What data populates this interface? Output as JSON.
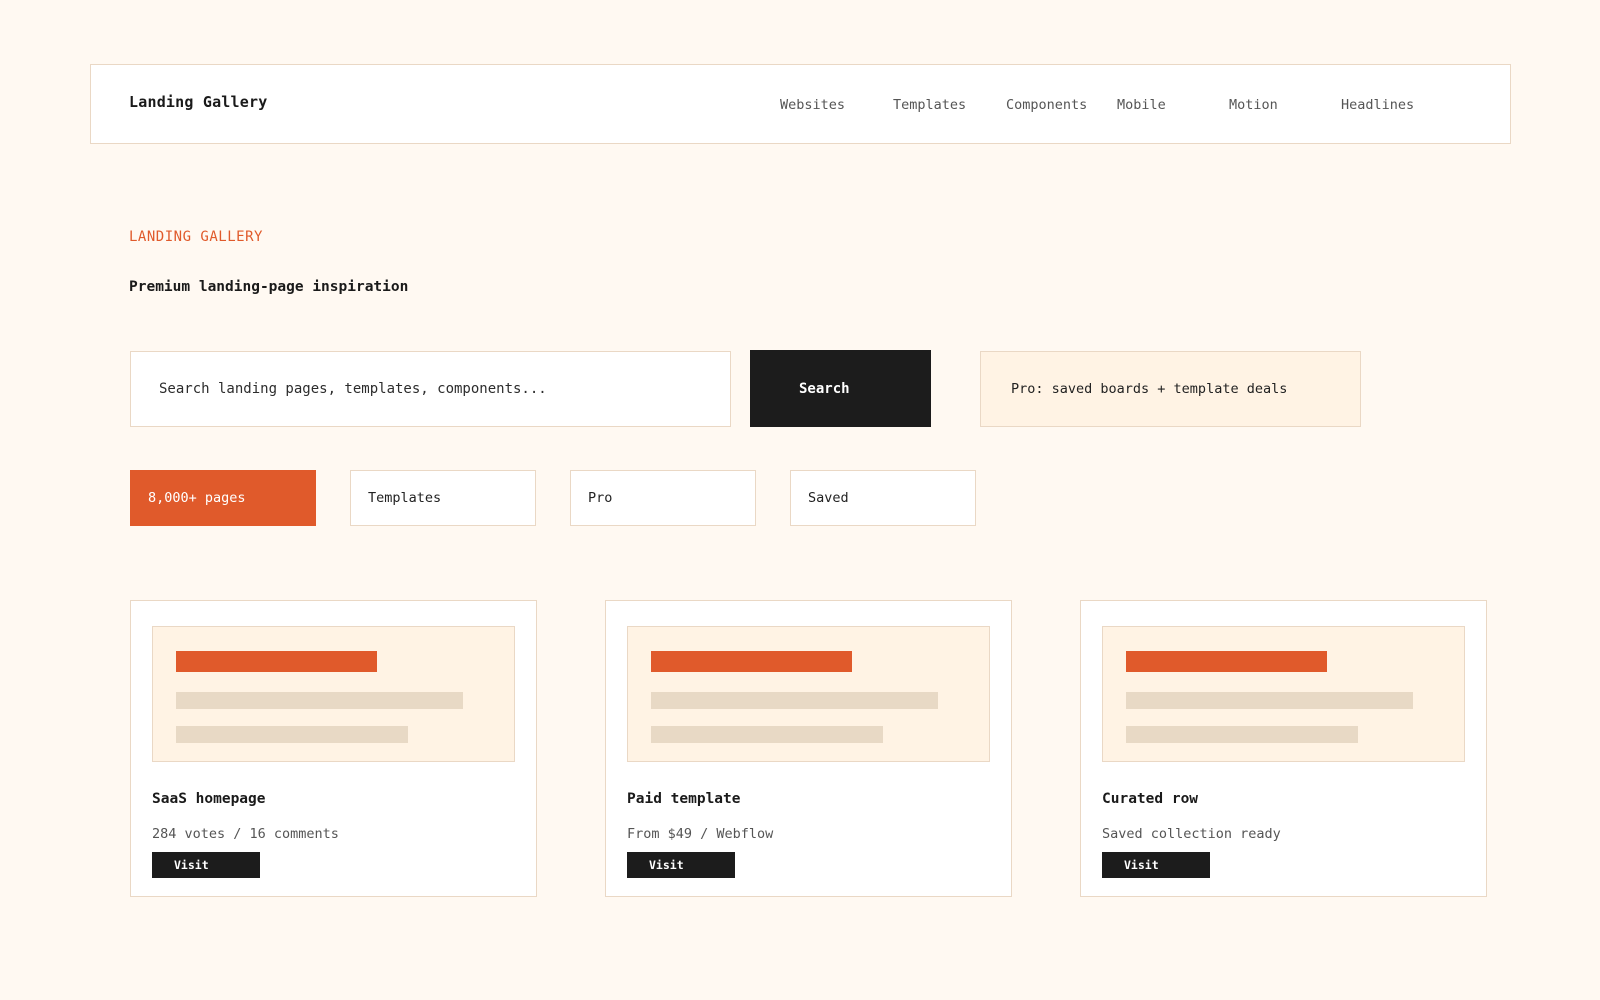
{
  "header": {
    "brand": "Landing Gallery",
    "nav": [
      "Websites",
      "Templates",
      "Components",
      "Mobile",
      "Motion",
      "Headlines"
    ]
  },
  "hero": {
    "eyebrow": "LANDING GALLERY",
    "headline": "Premium landing-page inspiration"
  },
  "search": {
    "placeholder": "Search landing pages, templates, components...",
    "button_label": "Search"
  },
  "promo": {
    "text": "Pro: saved boards + template deals"
  },
  "chips": [
    {
      "label": "8,000+ pages",
      "active": true
    },
    {
      "label": "Templates",
      "active": false
    },
    {
      "label": "Pro",
      "active": false
    },
    {
      "label": "Saved",
      "active": false
    }
  ],
  "cards": [
    {
      "title": "SaaS homepage",
      "meta": "284 votes / 16 comments",
      "button": "Visit"
    },
    {
      "title": "Paid template",
      "meta": "From $49 / Webflow",
      "button": "Visit"
    },
    {
      "title": "Curated row",
      "meta": "Saved collection ready",
      "button": "Visit"
    }
  ],
  "colors": {
    "background": "#fff9f2",
    "accent": "#e05a2b",
    "dark": "#1c1c1c",
    "panel": "#fff3e4",
    "border": "#ead8c5"
  }
}
